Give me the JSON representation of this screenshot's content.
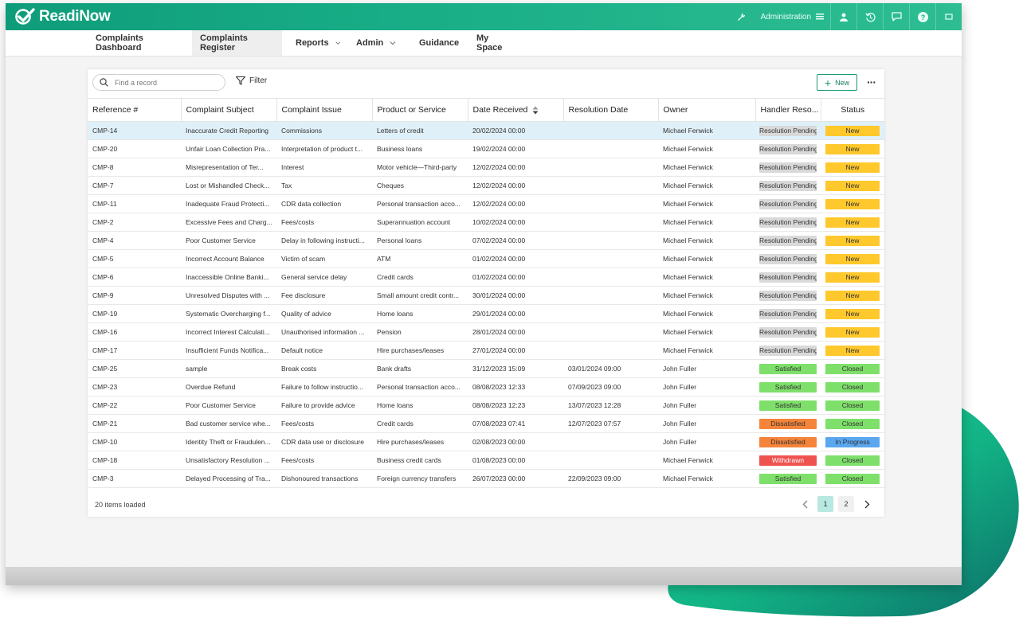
{
  "app": {
    "logo_text": "ReadiNow",
    "brand_color": "#18ad86"
  },
  "topbar": {
    "admin_label": "Administration",
    "icons": [
      "wrench-icon",
      "hamburger-icon",
      "user-icon",
      "history-icon",
      "chat-icon",
      "help-icon",
      "fullscreen-icon"
    ]
  },
  "nav": {
    "items": [
      {
        "label": "Complaints Dashboard",
        "active": false,
        "dropdown": false
      },
      {
        "label": "Complaints Register",
        "active": true,
        "dropdown": false
      },
      {
        "label": "Reports",
        "active": false,
        "dropdown": true
      },
      {
        "label": "Admin",
        "active": false,
        "dropdown": true
      },
      {
        "label": "Guidance",
        "active": false,
        "dropdown": false
      },
      {
        "label": "My Space",
        "active": false,
        "dropdown": false
      }
    ]
  },
  "toolbar": {
    "search_placeholder": "Find a record",
    "filter_label": "Filter",
    "new_label": "New",
    "more_label": "···"
  },
  "table": {
    "columns": [
      "Reference #",
      "Complaint Subject",
      "Complaint Issue",
      "Product or Service",
      "Date Received",
      "Resolution Date",
      "Owner",
      "Handler Reso...",
      "Status"
    ],
    "rows": [
      [
        "CMP-14",
        "Inaccurate Credit Reporting",
        "Commissions",
        "Letters of credit",
        "20/02/2024 00:00",
        "",
        "Michael Fenwick",
        "Resolution Pending",
        "New"
      ],
      [
        "CMP-20",
        "Unfair Loan Collection Pra...",
        "Interpretation of product t...",
        "Business loans",
        "19/02/2024 00:00",
        "",
        "Michael Fenwick",
        "Resolution Pending",
        "New"
      ],
      [
        "CMP-8",
        "Misrepresentation of Ter...",
        "Interest",
        "Motor vehicle—Third-party",
        "12/02/2024 00:00",
        "",
        "Michael Fenwick",
        "Resolution Pending",
        "New"
      ],
      [
        "CMP-7",
        "Lost or Mishandled Check...",
        "Tax",
        "Cheques",
        "12/02/2024 00:00",
        "",
        "Michael Fenwick",
        "Resolution Pending",
        "New"
      ],
      [
        "CMP-11",
        "Inadequate Fraud Protecti...",
        "CDR data collection",
        "Personal transaction acco...",
        "12/02/2024 00:00",
        "",
        "Michael Fenwick",
        "Resolution Pending",
        "New"
      ],
      [
        "CMP-2",
        "Excessive Fees and Charg...",
        "Fees/costs",
        "Superannuation account",
        "10/02/2024 00:00",
        "",
        "Michael Fenwick",
        "Resolution Pending",
        "New"
      ],
      [
        "CMP-4",
        "Poor Customer Service",
        "Delay in following instructi...",
        "Personal loans",
        "07/02/2024 00:00",
        "",
        "Michael Fenwick",
        "Resolution Pending",
        "New"
      ],
      [
        "CMP-5",
        "Incorrect Account Balance",
        "Victim of scam",
        "ATM",
        "01/02/2024 00:00",
        "",
        "Michael Fenwick",
        "Resolution Pending",
        "New"
      ],
      [
        "CMP-6",
        "Inaccessible Online Banki...",
        "General service delay",
        "Credit cards",
        "01/02/2024 00:00",
        "",
        "Michael Fenwick",
        "Resolution Pending",
        "New"
      ],
      [
        "CMP-9",
        "Unresolved Disputes with ...",
        "Fee disclosure",
        "Small amount credit contr...",
        "30/01/2024 00:00",
        "",
        "Michael Fenwick",
        "Resolution Pending",
        "New"
      ],
      [
        "CMP-19",
        "Systematic Overcharging f...",
        "Quality of advice",
        "Home loans",
        "29/01/2024 00:00",
        "",
        "Michael Fenwick",
        "Resolution Pending",
        "New"
      ],
      [
        "CMP-16",
        "Incorrect Interest Calculati...",
        "Unauthorised information ...",
        "Pension",
        "28/01/2024 00:00",
        "",
        "Michael Fenwick",
        "Resolution Pending",
        "New"
      ],
      [
        "CMP-17",
        "Insufficient Funds Notifica...",
        "Default notice",
        "Hire purchases/leases",
        "27/01/2024 00:00",
        "",
        "Michael Fenwick",
        "Resolution Pending",
        "New"
      ],
      [
        "CMP-25",
        "sample",
        "Break costs",
        "Bank drafts",
        "31/12/2023 15:09",
        "03/01/2024 09:00",
        "John Fuller",
        "Satisfied",
        "Closed"
      ],
      [
        "CMP-23",
        "Overdue Refund",
        "Failure to follow instructio...",
        "Personal transaction acco...",
        "08/08/2023 12:33",
        "07/09/2023 09:00",
        "John Fuller",
        "Satisfied",
        "Closed"
      ],
      [
        "CMP-22",
        "Poor Customer Service",
        "Failure to provide advice",
        "Home loans",
        "08/08/2023 12:23",
        "13/07/2023 12:28",
        "John Fuller",
        "Satisfied",
        "Closed"
      ],
      [
        "CMP-21",
        "Bad customer service whe...",
        "Fees/costs",
        "Credit cards",
        "07/08/2023 07:41",
        "12/07/2023 07:57",
        "John Fuller",
        "Dissatisfied",
        "Closed"
      ],
      [
        "CMP-10",
        "Identity Theft or Fraudulen...",
        "CDR data use or disclosure",
        "Hire purchases/leases",
        "02/08/2023 00:00",
        "",
        "John Fuller",
        "Dissatisfied",
        "In Progress"
      ],
      [
        "CMP-18",
        "Unsatisfactory Resolution ...",
        "Fees/costs",
        "Business credit cards",
        "01/08/2023 00:00",
        "",
        "Michael Fenwick",
        "Withdrawn",
        "Closed"
      ],
      [
        "CMP-3",
        "Delayed Processing of Tra...",
        "Dishonoured transactions",
        "Foreign currency transfers",
        "26/07/2023 00:00",
        "22/09/2023 09:00",
        "Michael Fenwick",
        "Satisfied",
        "Closed"
      ]
    ],
    "selected_row": 0
  },
  "badge_colors": {
    "Resolution Pending": "#d9d9d9",
    "Satisfied": "#7ee06a",
    "Dissatisfied": "#f5843a",
    "Withdrawn": "#ef5350",
    "New": "#ffc82c",
    "Closed": "#7ee06a",
    "In Progress": "#5aa7f0"
  },
  "footer": {
    "count_text": "20 items loaded",
    "pages": [
      "1",
      "2"
    ],
    "current_page": "1"
  }
}
